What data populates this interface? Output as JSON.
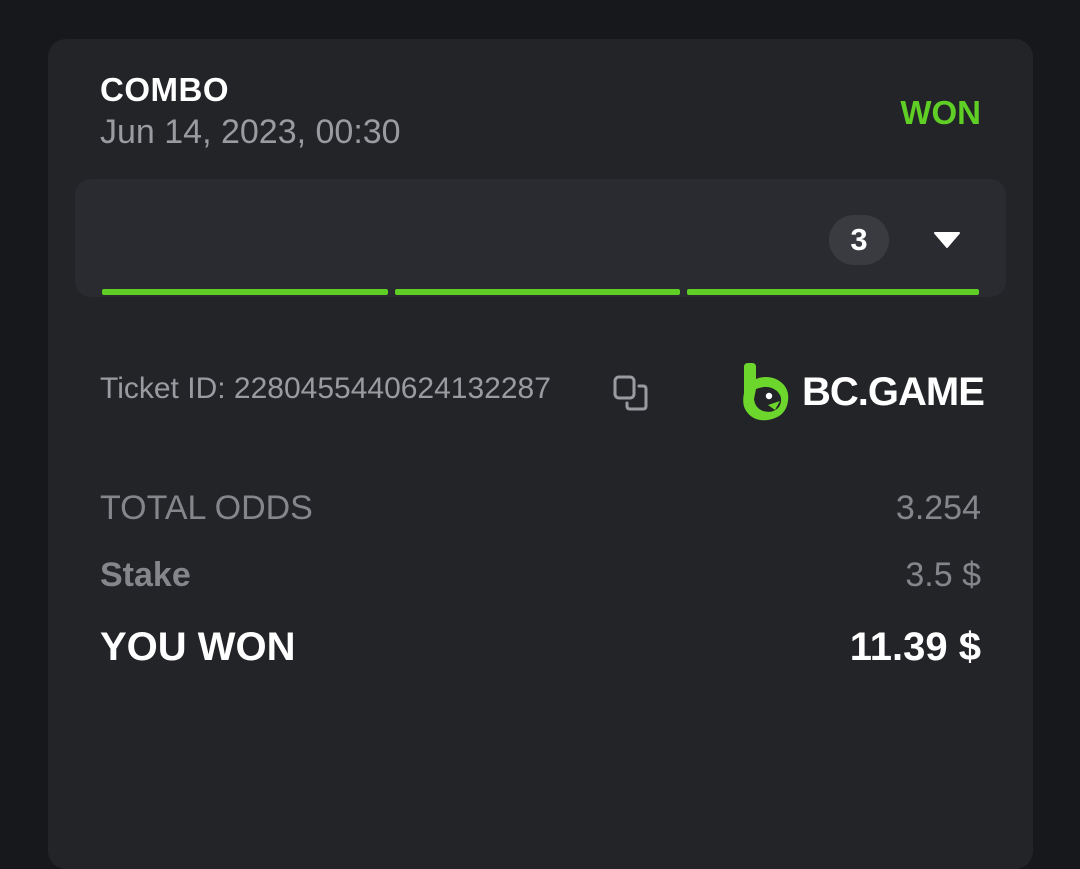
{
  "bet": {
    "type": "COMBO",
    "date": "Jun 14, 2023, 00:30",
    "status": "WON",
    "legs_count": "3",
    "expand_icon": "caret-down-icon",
    "leg_progress": [
      1,
      1,
      1
    ]
  },
  "ticket": {
    "label": "Ticket ID: ",
    "id": "2280455440624132287",
    "copy_icon": "copy-icon"
  },
  "brand": {
    "name": "BC.GAME",
    "logo_icon": "bcgame-logo-icon"
  },
  "summary": {
    "total_odds_label": "TOTAL ODDS",
    "total_odds_value": "3.254",
    "stake_label": "Stake",
    "stake_value": "3.5 $",
    "won_label": "YOU WON",
    "won_value": "11.39 $"
  },
  "colors": {
    "background": "#17181b",
    "card": "#232428",
    "accent_green": "#5fcf25",
    "muted_text": "#9a9ba0",
    "white": "#ffffff"
  }
}
